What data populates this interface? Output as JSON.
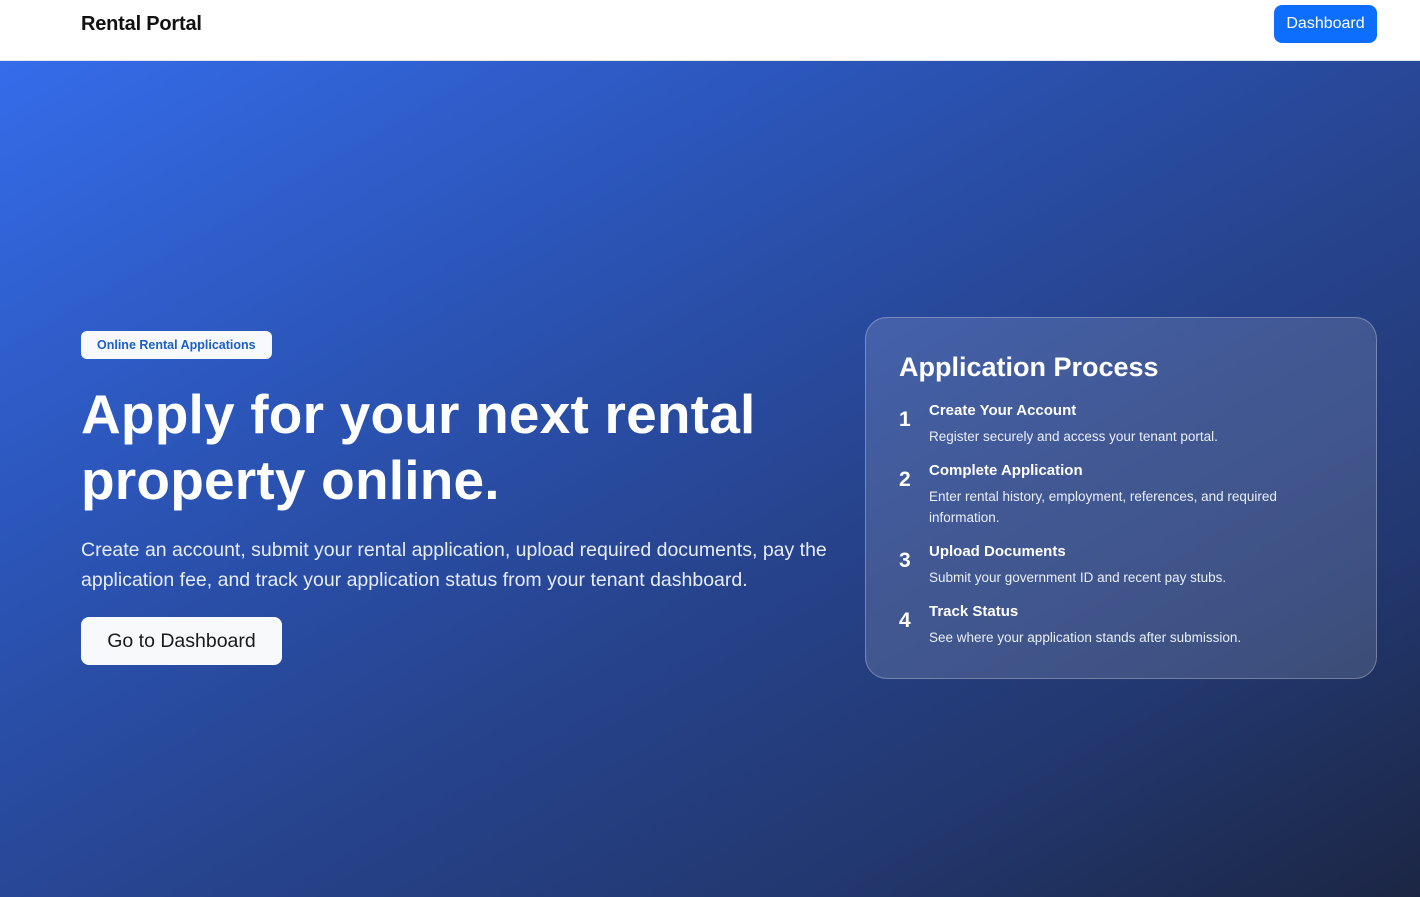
{
  "header": {
    "brand": "Rental Portal",
    "dashboard_button": "Dashboard"
  },
  "hero": {
    "badge": "Online Rental Applications",
    "headline": "Apply for your next rental property online.",
    "lead": "Create an account, submit your rental application, upload required documents, pay the application fee, and track your application status from your tenant dashboard.",
    "cta": "Go to Dashboard"
  },
  "process": {
    "title": "Application Process",
    "steps": [
      {
        "number": "1",
        "title": "Create Your Account",
        "description": "Register securely and access your tenant portal."
      },
      {
        "number": "2",
        "title": "Complete Application",
        "description": "Enter rental history, employment, references, and required information."
      },
      {
        "number": "3",
        "title": "Upload Documents",
        "description": "Submit your government ID and recent pay stubs."
      },
      {
        "number": "4",
        "title": "Track Status",
        "description": "See where your application stands after submission."
      }
    ]
  },
  "colors": {
    "accent": "#0d6efd",
    "hero_gradient_start": "#356cea",
    "hero_gradient_end": "#1c2644"
  }
}
